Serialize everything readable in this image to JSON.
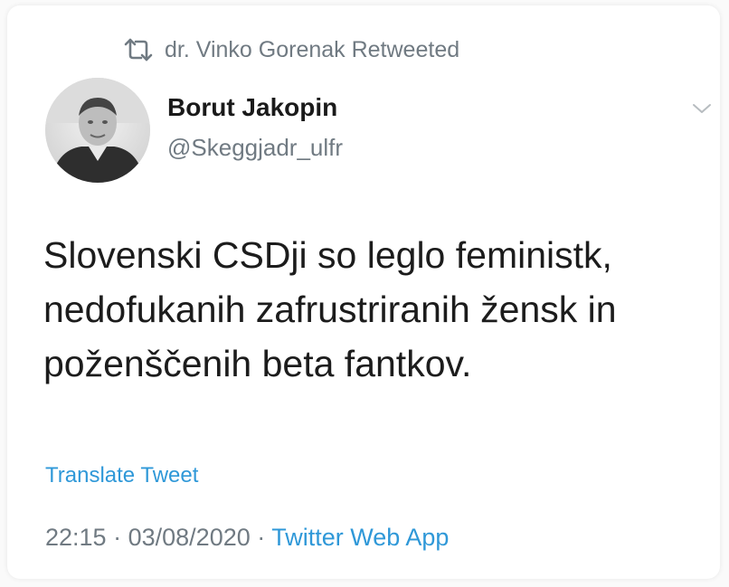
{
  "retweet": {
    "icon": "retweet-icon",
    "label": "dr. Vinko Gorenak Retweeted"
  },
  "author": {
    "name": "Borut Jakopin",
    "handle": "@Skeggjadr_ulfr",
    "avatar": "avatar-photo"
  },
  "menu": {
    "icon": "chevron-down-icon"
  },
  "tweet": {
    "lines": [
      "Slovenski CSDji so leglo feministk,",
      "nedofukanih zafrustriranih žensk in",
      "poženščenih beta fantkov."
    ]
  },
  "translate_label": "Translate Tweet",
  "meta": {
    "time": "22:15",
    "separator": "·",
    "date": "03/08/2020",
    "source": "Twitter Web App"
  },
  "colors": {
    "accent": "#2f98d8",
    "muted": "#707a82",
    "text": "#1c1c1c"
  }
}
